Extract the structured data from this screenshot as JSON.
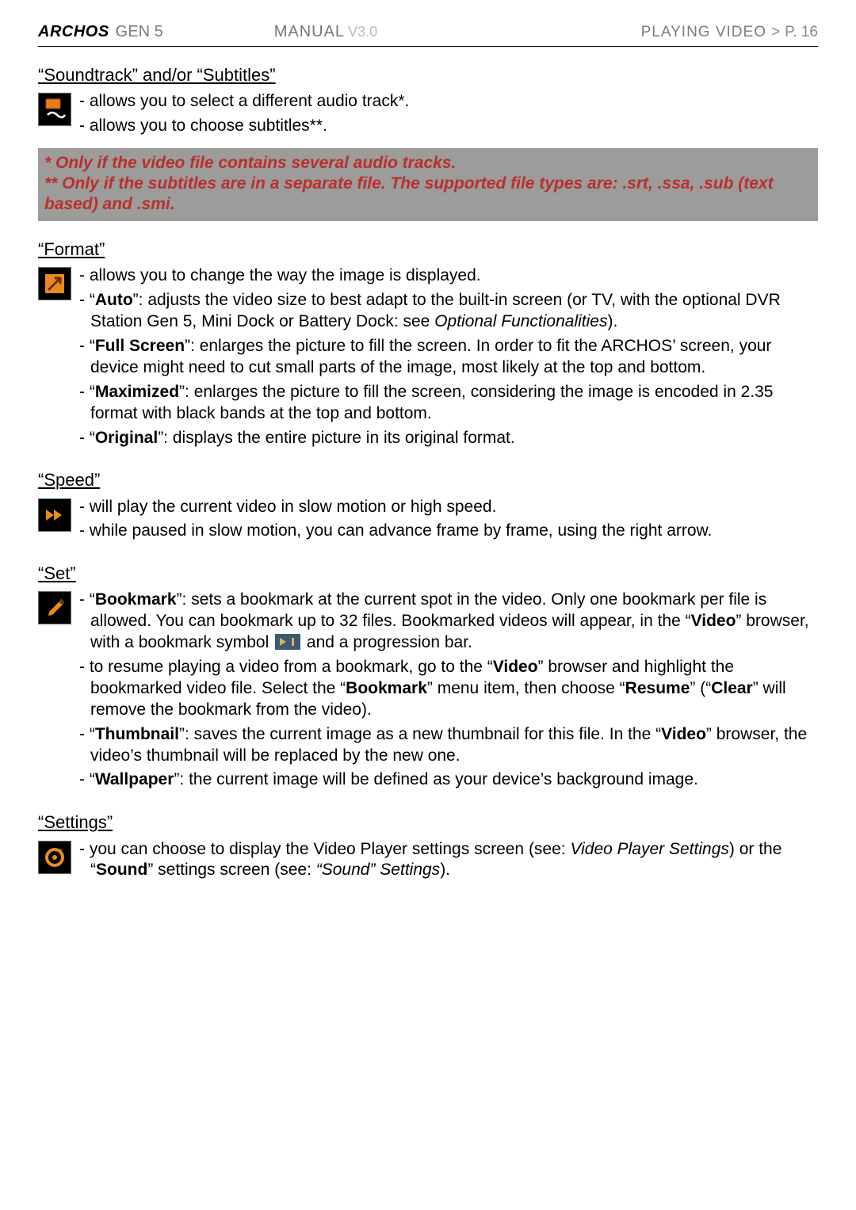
{
  "header": {
    "brand": "ARCHOS",
    "gen": "GEN 5",
    "manual": "MANUAL",
    "version": "V3.0",
    "section": "PLAYING VIDEO",
    "gt": ">",
    "page": "P. 16"
  },
  "soundtrack": {
    "title": "“Soundtrack” and/or “Subtitles”",
    "items": [
      "allows you to select a different audio track*.",
      "allows you to choose subtitles**."
    ]
  },
  "note": {
    "l1": "* Only if the video file contains several audio tracks.",
    "l2": "** Only if the subtitles are in a separate file. The supported file types are: .srt, .ssa, .sub (text based) and .smi."
  },
  "format": {
    "title": "“Format”",
    "lead": "allows you to change the way the image is displayed.",
    "auto_b": "Auto",
    "auto_t1": "”: adjusts the video size to best adapt to the built-in screen (or TV, with the optional DVR Station Gen 5, Mini Dock or Battery Dock: see ",
    "auto_i": "Optional Functionalities",
    "auto_t2": ").",
    "full_b": "Full Screen",
    "full_t": "”: enlarges the picture to fill the screen. In order to fit the ARCHOS’ screen, your device might need to cut small parts of the image, most likely at the top and bottom.",
    "max_b": "Maximized",
    "max_t": "”: enlarges the picture to fill the screen, considering the image is encoded in 2.35 format with black bands at the top and bottom.",
    "orig_b": "Original",
    "orig_t": "”: displays the entire picture in its original format."
  },
  "speed": {
    "title": "“Speed”",
    "items": [
      "will play the current video in slow motion or high speed.",
      "while paused in slow motion, you can advance frame by frame, using the right arrow."
    ]
  },
  "set": {
    "title": "“Set”",
    "bm_b": "Bookmark",
    "bm_t1": "”: sets a bookmark at the current spot in the video. Only one bookmark per file is allowed. You can bookmark up to 32 files. Bookmarked videos will appear, in the “",
    "bm_b2": "Video",
    "bm_t2": "” browser, with a bookmark symbol ",
    "bm_t3": " and a progression bar.",
    "res_t1": "to resume playing a video from a bookmark, go to the “",
    "res_b1": "Video",
    "res_t2": "” browser and highlight the bookmarked video file. Select the “",
    "res_b2": "Bookmark",
    "res_t3": "” menu item, then choose “",
    "res_b3": "Resume",
    "res_t4": "” (“",
    "res_b4": "Clear",
    "res_t5": "” will remove the bookmark from the video).",
    "th_b": "Thumbnail",
    "th_t1": "”: saves the current image as a new thumbnail for this file. In the “",
    "th_b2": "Video",
    "th_t2": "” browser, the video’s thumbnail will be replaced by the new one.",
    "wp_b": "Wallpaper",
    "wp_t": "”: the current image will be defined as your device’s background image."
  },
  "settings": {
    "title": "“Settings”",
    "t1": "you can choose to display the Video Player settings screen (see: ",
    "i1": "Video Player Settings",
    "t2": ") or the “",
    "b1": "Sound",
    "t3": "” settings screen (see: ",
    "i2": "“Sound” Settings",
    "t4": ")."
  }
}
